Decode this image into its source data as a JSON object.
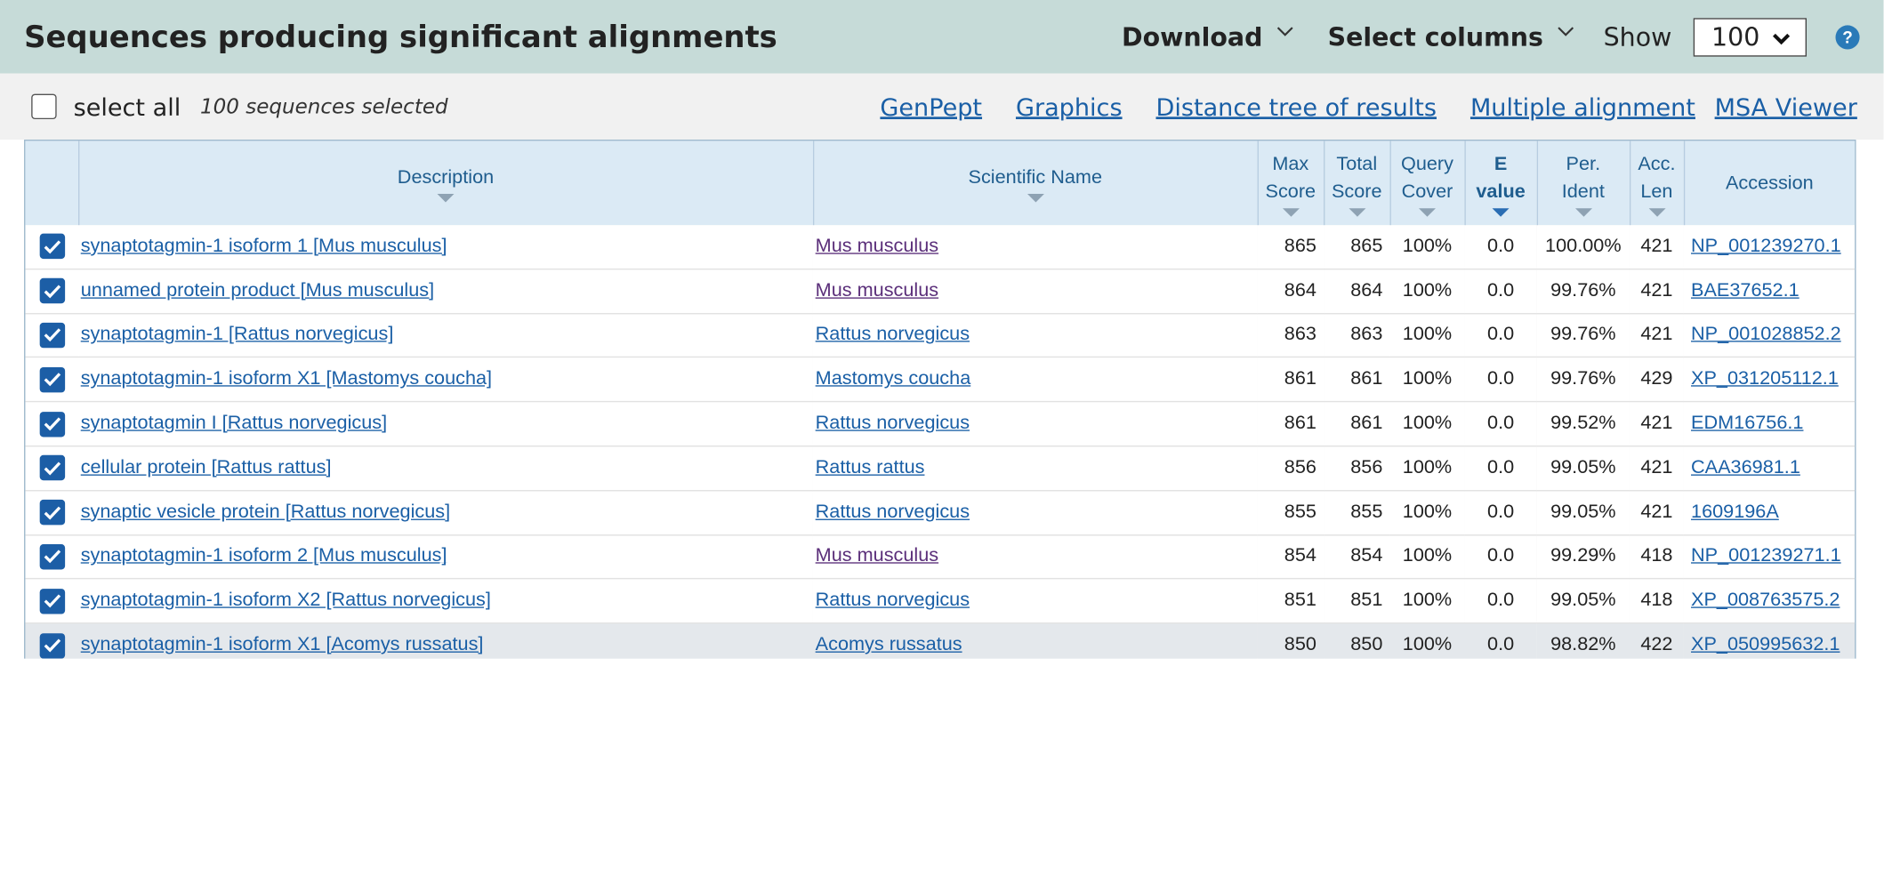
{
  "header": {
    "title": "Sequences producing significant alignments",
    "download_label": "Download",
    "select_columns_label": "Select columns",
    "show_label": "Show",
    "show_value": "100",
    "help_glyph": "?"
  },
  "toolbar": {
    "select_all_label": "select all",
    "selected_count": "100 sequences selected",
    "links": [
      "GenPept",
      "Graphics",
      "Distance tree of results",
      "Multiple alignment",
      "MSA Viewer"
    ]
  },
  "columns": {
    "description": "Description",
    "scientific_name": "Scientific Name",
    "max_score": [
      "Max",
      "Score"
    ],
    "total_score": [
      "Total",
      "Score"
    ],
    "query_cover": [
      "Query",
      "Cover"
    ],
    "e_value": [
      "E",
      "value"
    ],
    "per_ident": [
      "Per.",
      "Ident"
    ],
    "acc_len": [
      "Acc.",
      "Len"
    ],
    "accession": "Accession"
  },
  "rows": [
    {
      "desc": "synaptotagmin-1 isoform 1 [Mus musculus]",
      "sci": "Mus musculus",
      "max": "865",
      "total": "865",
      "cover": "100%",
      "e": "0.0",
      "ident": "100.00%",
      "len": "421",
      "acc": "NP_001239270.1"
    },
    {
      "desc": "unnamed protein product [Mus musculus]",
      "sci": "Mus musculus",
      "max": "864",
      "total": "864",
      "cover": "100%",
      "e": "0.0",
      "ident": "99.76%",
      "len": "421",
      "acc": "BAE37652.1"
    },
    {
      "desc": "synaptotagmin-1 [Rattus norvegicus]",
      "sci": "Rattus norvegicus",
      "max": "863",
      "total": "863",
      "cover": "100%",
      "e": "0.0",
      "ident": "99.76%",
      "len": "421",
      "acc": "NP_001028852.2"
    },
    {
      "desc": "synaptotagmin-1 isoform X1 [Mastomys coucha]",
      "sci": "Mastomys coucha",
      "max": "861",
      "total": "861",
      "cover": "100%",
      "e": "0.0",
      "ident": "99.76%",
      "len": "429",
      "acc": "XP_031205112.1"
    },
    {
      "desc": "synaptotagmin I [Rattus norvegicus]",
      "sci": "Rattus norvegicus",
      "max": "861",
      "total": "861",
      "cover": "100%",
      "e": "0.0",
      "ident": "99.52%",
      "len": "421",
      "acc": "EDM16756.1"
    },
    {
      "desc": "cellular protein [Rattus rattus]",
      "sci": "Rattus rattus",
      "max": "856",
      "total": "856",
      "cover": "100%",
      "e": "0.0",
      "ident": "99.05%",
      "len": "421",
      "acc": "CAA36981.1"
    },
    {
      "desc": "synaptic vesicle protein [Rattus norvegicus]",
      "sci": "Rattus norvegicus",
      "max": "855",
      "total": "855",
      "cover": "100%",
      "e": "0.0",
      "ident": "99.05%",
      "len": "421",
      "acc": "1609196A"
    },
    {
      "desc": "synaptotagmin-1 isoform 2 [Mus musculus]",
      "sci": "Mus musculus",
      "max": "854",
      "total": "854",
      "cover": "100%",
      "e": "0.0",
      "ident": "99.29%",
      "len": "418",
      "acc": "NP_001239271.1"
    },
    {
      "desc": "synaptotagmin-1 isoform X2 [Rattus norvegicus]",
      "sci": "Rattus norvegicus",
      "max": "851",
      "total": "851",
      "cover": "100%",
      "e": "0.0",
      "ident": "99.05%",
      "len": "418",
      "acc": "XP_008763575.2"
    },
    {
      "desc": "synaptotagmin-1 isoform X1 [Acomys russatus]",
      "sci": "Acomys russatus",
      "max": "850",
      "total": "850",
      "cover": "100%",
      "e": "0.0",
      "ident": "98.82%",
      "len": "422",
      "acc": "XP_050995632.1"
    }
  ],
  "colors": {
    "accent": "#1c5ea6",
    "header_band": "#c6dbd8",
    "column_header": "#dbeaf5",
    "link": "#1a5fa6",
    "visited_link": "#5b2f7a"
  }
}
